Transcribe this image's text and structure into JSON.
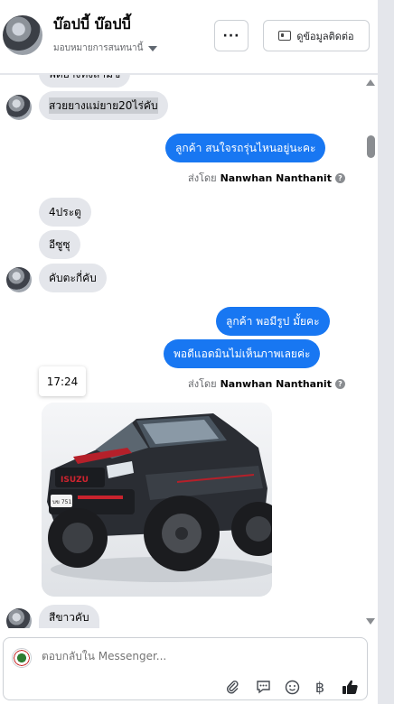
{
  "header": {
    "name": "บ๊อปบี้ บ๊อปบี้",
    "assign_label": "มอบหมายการสนทนานี้",
    "more_label": "···",
    "contact_label": "ดูข้อมูลติดต่อ"
  },
  "messages": {
    "partial_top": "พิดยางทั้งสามช",
    "m1": "สวยยางแม่ยาย20ไร่คับ",
    "m2": "ลูกค้า สนใจรถรุ่นไหนอยู่นะคะ",
    "sent_by_prefix": "ส่งโดย",
    "sent_by_name": "Nanwhan Nanthanit",
    "m3": "4ประตู",
    "m4": "อีซูซุ",
    "m5": "คับตะกี่คับ",
    "m6": "ลูกค้า พอมีรูป มั้ยคะ",
    "m7": "พอดีแอดมินไม่เห็นภาพเลยค่ะ",
    "time_tooltip": "17:24",
    "m8": "สีขาวคับ",
    "plate_text": "บข 7511"
  },
  "composer": {
    "placeholder": "ตอบกลับใน Messenger..."
  },
  "icons": {
    "attach": "paperclip-icon",
    "saved_reply": "chat-bubble-icon",
    "emoji": "smiley-icon",
    "payment": "baht-icon",
    "like": "thumbs-up-icon"
  },
  "colors": {
    "outgoing_bubble": "#1877f2",
    "incoming_bubble": "#e4e6eb"
  }
}
